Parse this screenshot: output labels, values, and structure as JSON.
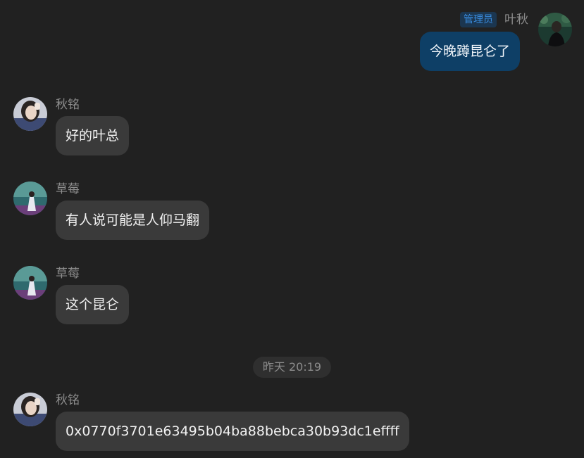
{
  "messages": [
    {
      "sender": "叶秋",
      "badge": "管理员",
      "text": "今晚蹲昆仑了",
      "self": true
    },
    {
      "sender": "秋铭",
      "text": "好的叶总"
    },
    {
      "sender": "草莓",
      "text": "有人说可能是人仰马翻"
    },
    {
      "sender": "草莓",
      "text": "这个昆仑"
    },
    {
      "sender": "秋铭",
      "text": "0x0770f3701e63495b04ba88bebca30b93dc1effff"
    }
  ],
  "timestamp": "昨天 20:19",
  "colors": {
    "background": "#212121",
    "bubble_other": "#3a3a3a",
    "bubble_self": "#0e3f66",
    "admin_badge_bg": "#1b3650",
    "admin_badge_text": "#3a8de0",
    "name_text": "#8d8d8d"
  }
}
